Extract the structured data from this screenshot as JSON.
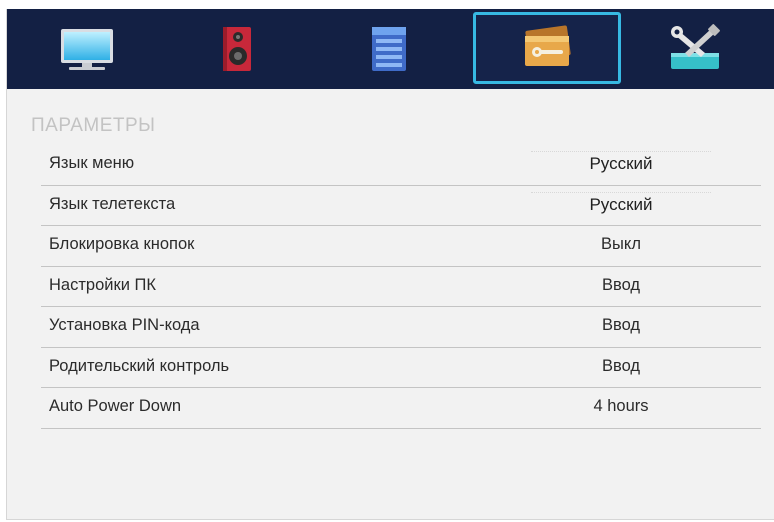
{
  "colors": {
    "topbar_bg": "#132044",
    "active_tab_border": "#37b9e3",
    "panel_bg": "#f2f2f2",
    "section_title": "#c3c3c3",
    "text": "#2b2b2b",
    "divider": "#c4c4c4"
  },
  "tabs": [
    {
      "icon": "monitor-icon",
      "active": false
    },
    {
      "icon": "speaker-icon",
      "active": false
    },
    {
      "icon": "channel-list-icon",
      "active": false
    },
    {
      "icon": "options-folder-icon",
      "active": true
    },
    {
      "icon": "tools-icon",
      "active": false
    }
  ],
  "section": {
    "title": "ПАРАМЕТРЫ"
  },
  "rows": [
    {
      "label": "Язык меню",
      "value": "Русский"
    },
    {
      "label": "Язык телетекста",
      "value": "Русский"
    },
    {
      "label": "Блокировка кнопок",
      "value": "Выкл"
    },
    {
      "label": "Настройки ПК",
      "value": "Ввод"
    },
    {
      "label": "Установка PIN-кода",
      "value": "Ввод"
    },
    {
      "label": "Родительский контроль",
      "value": "Ввод"
    },
    {
      "label": "Auto Power Down",
      "value": "4 hours"
    }
  ]
}
